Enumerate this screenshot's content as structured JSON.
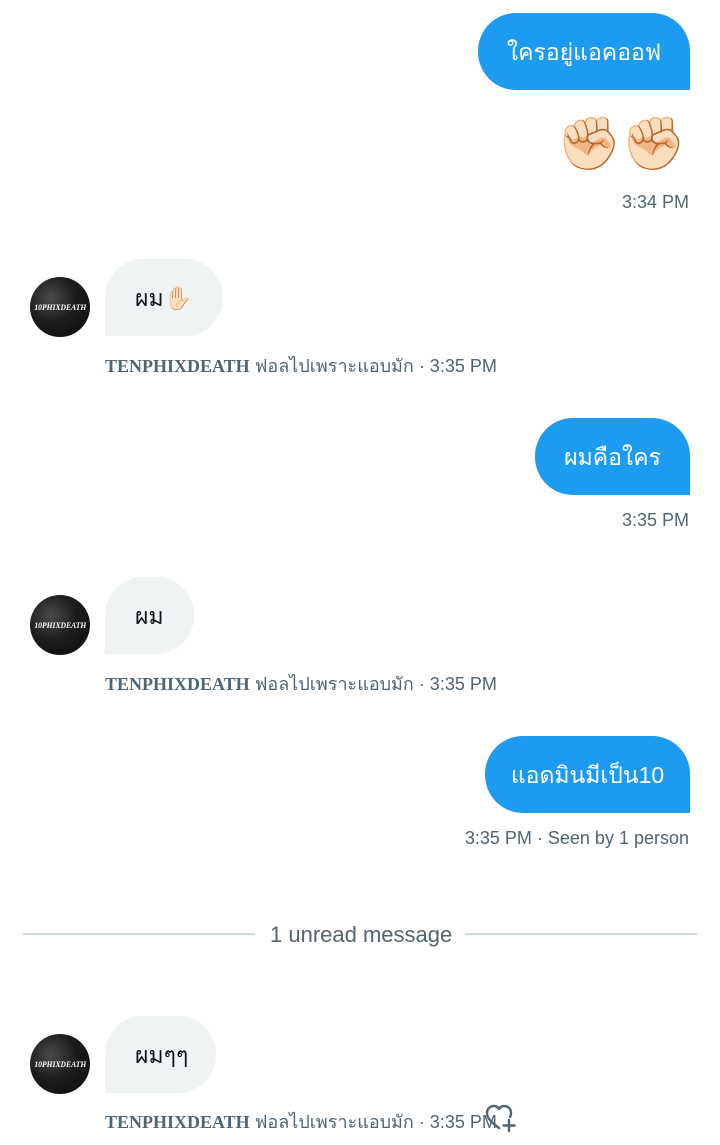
{
  "conversation": {
    "msg1": {
      "text": "ใครอยู่แอคออฟ"
    },
    "msg2": {
      "emoji": "✊🏻✊🏻",
      "time": "3:34 PM"
    },
    "msg3": {
      "text": "ผม✋🏻",
      "sender": "TENPHIXDEATH",
      "sender_rest": " ฟอลไปเพราะแอบมัก · 3:35 PM"
    },
    "msg4": {
      "text": "ผมคือใคร",
      "time": "3:35 PM"
    },
    "msg5": {
      "text": "ผม",
      "sender": "TENPHIXDEATH",
      "sender_rest": " ฟอลไปเพราะแอบมัก · 3:35 PM"
    },
    "msg6": {
      "text": "แอดมินมีเป็น10",
      "time": "3:35 PM · Seen by 1 person"
    },
    "divider": {
      "text": "1 unread message"
    },
    "msg7": {
      "text": "ผมๆๆ",
      "sender": "TENPHIXDEATH",
      "sender_rest": " ฟอลไปเพราะแอบมัก · 3:35 PM"
    }
  },
  "avatar": {
    "label": "10PHIXDEATH"
  },
  "icons": {
    "react": "heart-plus-icon"
  },
  "colors": {
    "accent": "#1d9bf0",
    "incoming_bg": "#eff3f4",
    "meta": "#536471",
    "divider": "#cfd9de"
  }
}
